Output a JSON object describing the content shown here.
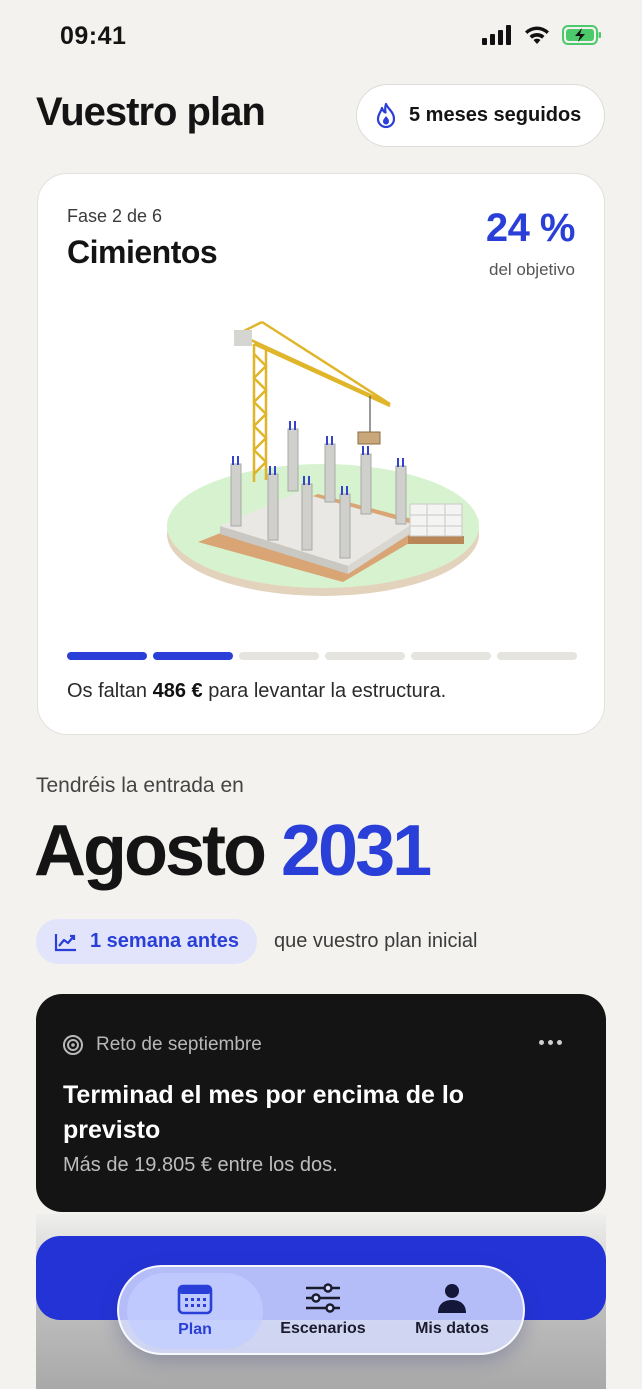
{
  "status": {
    "time": "09:41"
  },
  "header": {
    "title": "Vuestro plan",
    "streak_label": "5 meses seguidos"
  },
  "plan_card": {
    "phase_label": "Fase 2 de 6",
    "phase_name": "Cimientos",
    "percent_label": "24 %",
    "percent_caption": "del objetivo",
    "progress": {
      "completed_segments": 2,
      "total_segments": 6
    },
    "remaining_prefix": "Os faltan",
    "remaining_amount": "486 €",
    "remaining_suffix": "para levantar la estructura."
  },
  "entry": {
    "caption": "Tendréis la entrada en",
    "month": "Agosto",
    "year": "2031",
    "ahead_label": "1 semana antes",
    "ahead_suffix": "que vuestro plan inicial"
  },
  "challenge": {
    "label": "Reto de septiembre",
    "title": "Terminad el mes por encima de lo previsto",
    "subtitle": "Más de 19.805 € entre los dos."
  },
  "tabs": [
    {
      "label": "Plan",
      "icon": "calendar-icon",
      "active": true
    },
    {
      "label": "Escenarios",
      "icon": "sliders-icon",
      "active": false
    },
    {
      "label": "Mis datos",
      "icon": "person-icon",
      "active": false
    }
  ],
  "colors": {
    "accent": "#2a3fd8",
    "background": "#f3f2ef",
    "card_dark": "#141414"
  }
}
